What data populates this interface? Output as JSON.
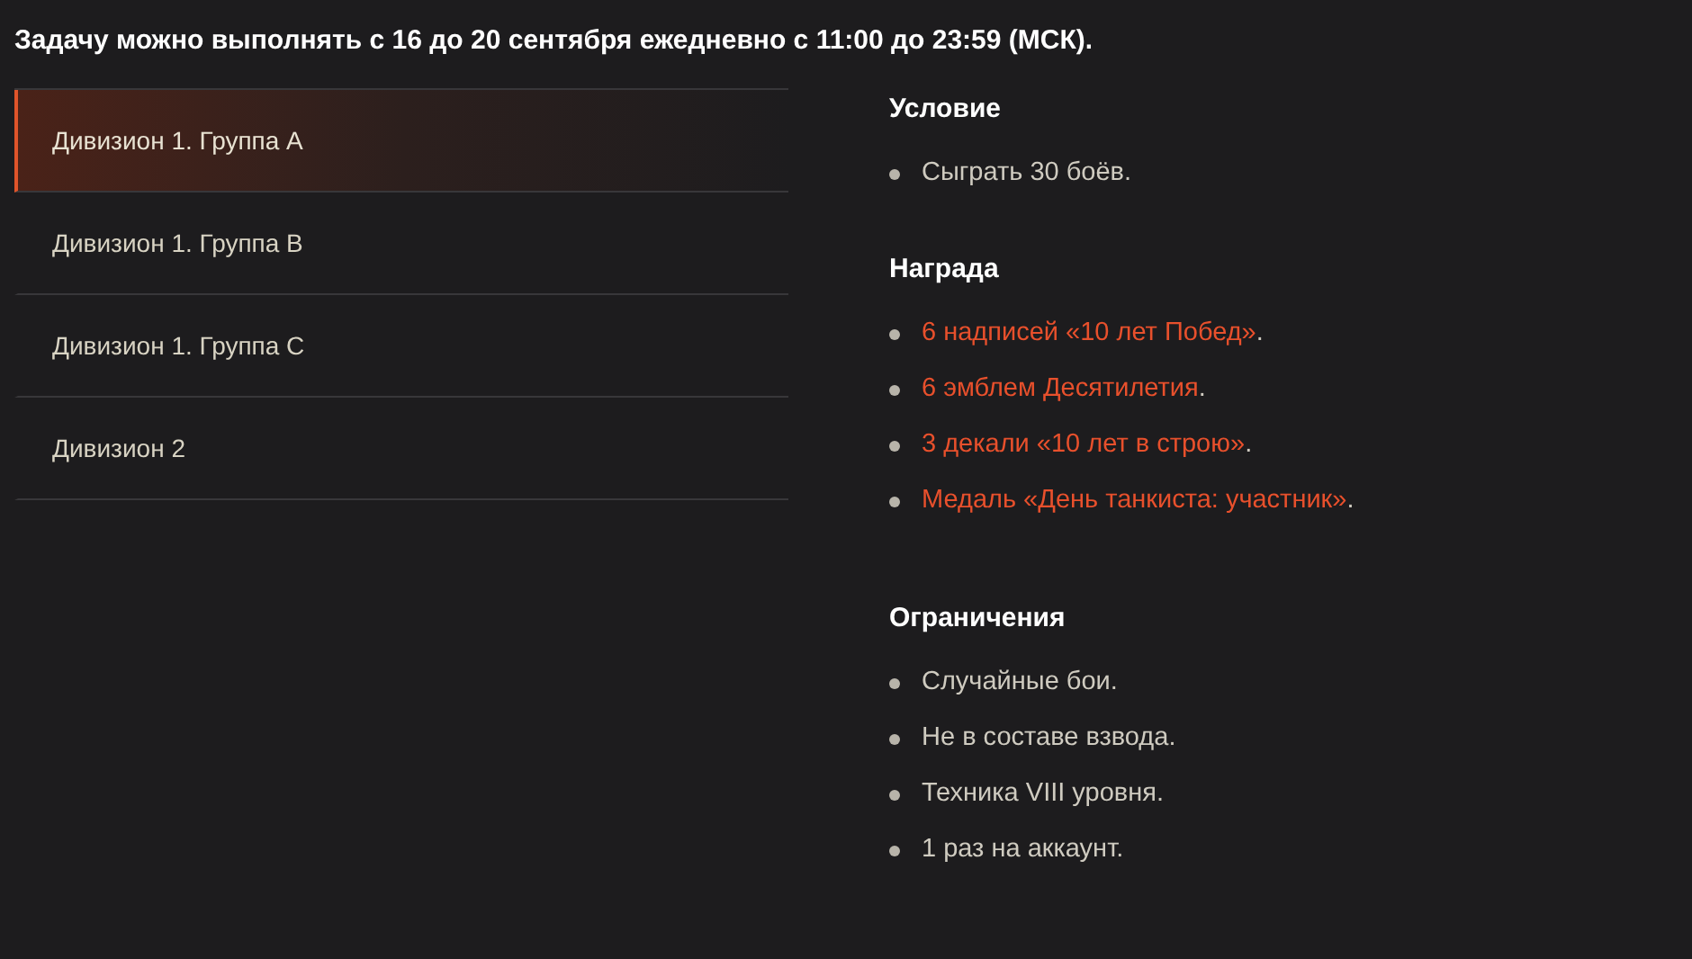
{
  "notice": "Задачу можно выполнять с 16 до 20 сентября ежедневно с 11:00 до 23:59 (МСК).",
  "tabs": [
    {
      "label": "Дивизион 1. Группа A",
      "selected": true
    },
    {
      "label": "Дивизион 1. Группа B",
      "selected": false
    },
    {
      "label": "Дивизион 1. Группа C",
      "selected": false
    },
    {
      "label": "Дивизион 2",
      "selected": false
    }
  ],
  "sections": [
    {
      "title": "Условие",
      "items": [
        {
          "text": "Сыграть 30 боёв."
        }
      ]
    },
    {
      "title": "Награда",
      "items": [
        {
          "link": "6 надписей «10 лет Побед»",
          "text": "."
        },
        {
          "link": "6 эмблем Десятилетия",
          "text": "."
        },
        {
          "link": "3 декали «10 лет в строю»",
          "text": "."
        },
        {
          "link": "Медаль «День танкиста: участник»",
          "text": "."
        }
      ]
    },
    {
      "title": "Ограничения",
      "items": [
        {
          "text": "Случайные бои."
        },
        {
          "text": "Не в составе взвода."
        },
        {
          "text": "Техника VIII уровня."
        },
        {
          "text": "1 раз на аккаунт."
        }
      ]
    }
  ]
}
